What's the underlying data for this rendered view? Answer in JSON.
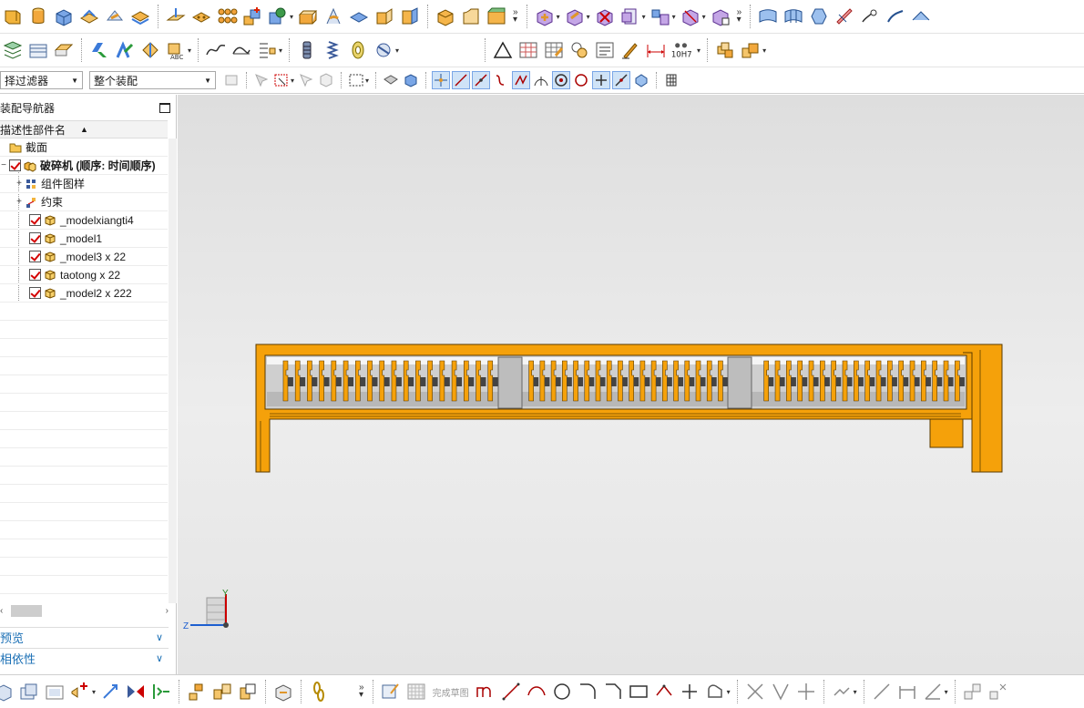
{
  "filter": {
    "selection_filter": "择过滤器",
    "scope": "整个装配"
  },
  "navigator": {
    "title": "装配导航器",
    "column_header": "描述性部件名",
    "tree": [
      {
        "label": "截面"
      },
      {
        "label": "破碎机 (顺序: 时间顺序)"
      },
      {
        "label": "组件图样"
      },
      {
        "label": "约束"
      },
      {
        "label": "_modelxiangti4"
      },
      {
        "label": "_model1"
      },
      {
        "label": "_model3 x 22"
      },
      {
        "label": "taotong x 22"
      },
      {
        "label": "_model2 x 222"
      }
    ],
    "preview_label": "预览",
    "dependency_label": "相依性"
  },
  "toolbar": {
    "dim_label": "10H7",
    "finish_sketch_label": "完成草图"
  },
  "triad": {
    "y_label": "Y",
    "z_label": "Z"
  },
  "colors": {
    "model_orange": "#f5a10a",
    "model_outline": "#5a3b00",
    "viewport_bg": "#e3e3e3",
    "link_blue": "#1a6fb5"
  }
}
